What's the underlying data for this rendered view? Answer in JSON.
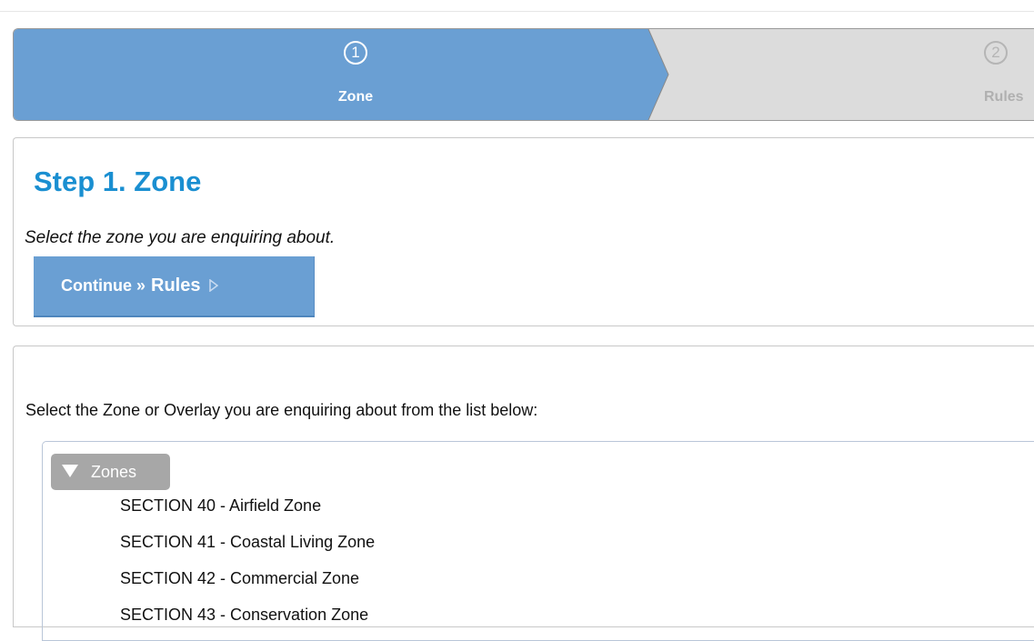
{
  "wizard": {
    "steps": [
      {
        "number": "1",
        "label": "Zone",
        "state": "active"
      },
      {
        "number": "2",
        "label": "Rules",
        "state": "inactive"
      }
    ],
    "active_color": "#6a9fd3",
    "inactive_color": "#dcdcdc"
  },
  "step_panel": {
    "title": "Step 1. Zone",
    "subtitle": "Select the zone you are enquiring about.",
    "continue_prefix": "Continue »",
    "continue_target": "Rules",
    "title_color": "#1a8fd1"
  },
  "zone_list": {
    "instructions": "Select the Zone or Overlay you are enquiring about from the list below:",
    "group_label": "Zones",
    "items": [
      "SECTION 40 - Airfield Zone",
      "SECTION 41 - Coastal Living Zone",
      "SECTION 42 - Commercial Zone",
      "SECTION 43 - Conservation Zone"
    ]
  }
}
